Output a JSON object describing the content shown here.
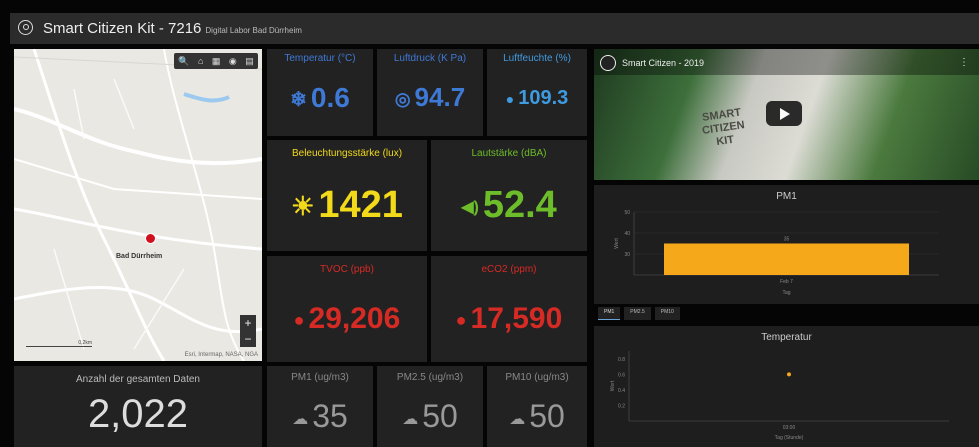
{
  "header": {
    "title": "Smart Citizen Kit - 7216",
    "subtitle": "Digital Labor Bad Dürrheim"
  },
  "map": {
    "tools": [
      "🔍",
      "⌂",
      "▦",
      "◉",
      "▤"
    ],
    "place_label": "Bad Dürrheim",
    "attribution": "Esri, Intermap, NASA, NGA",
    "scale": "0,2km",
    "zoom_in": "+",
    "zoom_out": "−"
  },
  "tiles": {
    "temperature": {
      "label": "Temperatur (°C)",
      "value": "0.6",
      "color": "#3f79d6"
    },
    "pressure": {
      "label": "Luftdruck (K Pa)",
      "value": "94.7",
      "color": "#3f79d6"
    },
    "humidity": {
      "label": "Luftfeuchte (%)",
      "value": "109.3",
      "color": "#3f9be0"
    },
    "illuminance": {
      "label": "Beleuchtungsstärke (lux)",
      "value": "1421",
      "color": "#f2da1a"
    },
    "loudness": {
      "label": "Lautstärke (dBA)",
      "value": "52.4",
      "color": "#6dbd2a"
    },
    "tvoc": {
      "label": "TVOC (ppb)",
      "value": "29,206",
      "color": "#d62a24"
    },
    "eco2": {
      "label": "eCO2 (ppm)",
      "value": "17,590",
      "color": "#d62a24"
    },
    "total": {
      "label": "Anzahl der gesamten Daten",
      "value": "2,022"
    },
    "pm1": {
      "label": "PM1 (ug/m3)",
      "value": "35"
    },
    "pm25": {
      "label": "PM2.5 (ug/m3)",
      "value": "50"
    },
    "pm10": {
      "label": "PM10 (ug/m3)",
      "value": "50"
    }
  },
  "video": {
    "title": "Smart Citizen - 2019",
    "shirt_text": "SMART CITIZEN KIT"
  },
  "charts_tabs": [
    "PM1",
    "PM2.5",
    "PM10"
  ],
  "chart_data": [
    {
      "type": "bar",
      "title": "PM1",
      "categories": [
        "Feb 7"
      ],
      "values": [
        35
      ],
      "ylim": [
        20,
        50
      ],
      "yticks": [
        "50",
        "40",
        "30"
      ],
      "data_labels": [
        "35"
      ],
      "xlabel": "Tag",
      "ylabel": "Wert",
      "color": "#f5a81a"
    },
    {
      "type": "scatter",
      "title": "Temperatur",
      "x": [
        "03:00"
      ],
      "values": [
        0.6
      ],
      "ylim": [
        0,
        0.9
      ],
      "yticks": [
        "0.8",
        "0.6",
        "0.4",
        "0.2"
      ],
      "xlabel": "Tag (Stunde)",
      "ylabel": "Wert",
      "color": "#f5a81a"
    }
  ]
}
